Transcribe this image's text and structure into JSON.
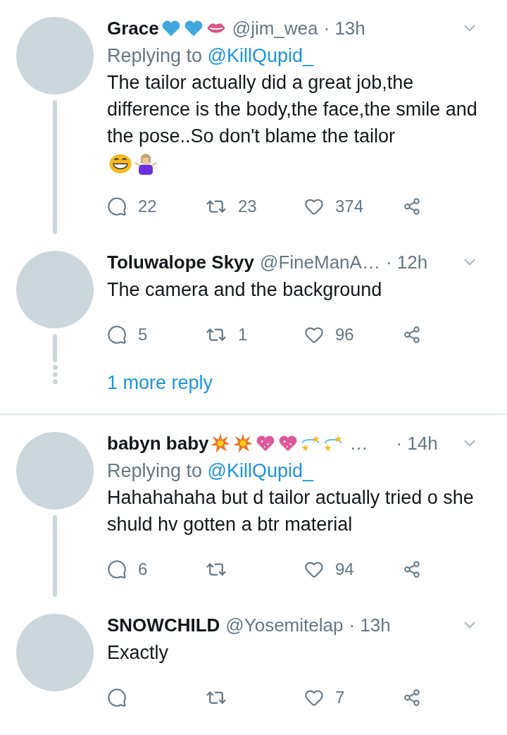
{
  "threads": [
    {
      "tweets": [
        {
          "name": "Grace",
          "name_emoji": [
            {
              "kind": "heart"
            },
            {
              "kind": "heart"
            },
            {
              "kind": "lips"
            }
          ],
          "handle": "@jim_wea",
          "time": "· 13h",
          "replying_prefix": "Replying to",
          "replying_handle": "@KillQupid_",
          "text": "The tailor actually did a great job,the difference is the body,the face,the smile and the pose..So don't blame the tailor",
          "text_emoji": [
            {
              "kind": "grin"
            },
            {
              "kind": "shrug"
            }
          ],
          "replies": "22",
          "retweets": "23",
          "likes": "374"
        },
        {
          "name": "Toluwalope Skyy",
          "handle": "@FineManA…",
          "time": "· 12h",
          "text": "The camera and the background",
          "replies": "5",
          "retweets": "1",
          "likes": "96"
        }
      ],
      "more_replies": "1 more reply"
    },
    {
      "tweets": [
        {
          "name": "babyn baby",
          "name_emoji": [
            {
              "kind": "collision"
            },
            {
              "kind": "collision"
            },
            {
              "kind": "sparkle_heart"
            },
            {
              "kind": "sparkle_heart"
            },
            {
              "kind": "dizzy"
            },
            {
              "kind": "dizzy"
            }
          ],
          "ellipsis": "…",
          "time": "· 14h",
          "replying_prefix": "Replying to",
          "replying_handle": "@KillQupid_",
          "text": "Hahahahaha but d tailor actually tried o she shuld hv gotten a btr material",
          "replies": "6",
          "likes": "94"
        },
        {
          "name": "SNOWCHILD",
          "handle": "@Yosemitelap",
          "time": "· 13h",
          "text": "Exactly",
          "likes": "7"
        }
      ]
    }
  ]
}
